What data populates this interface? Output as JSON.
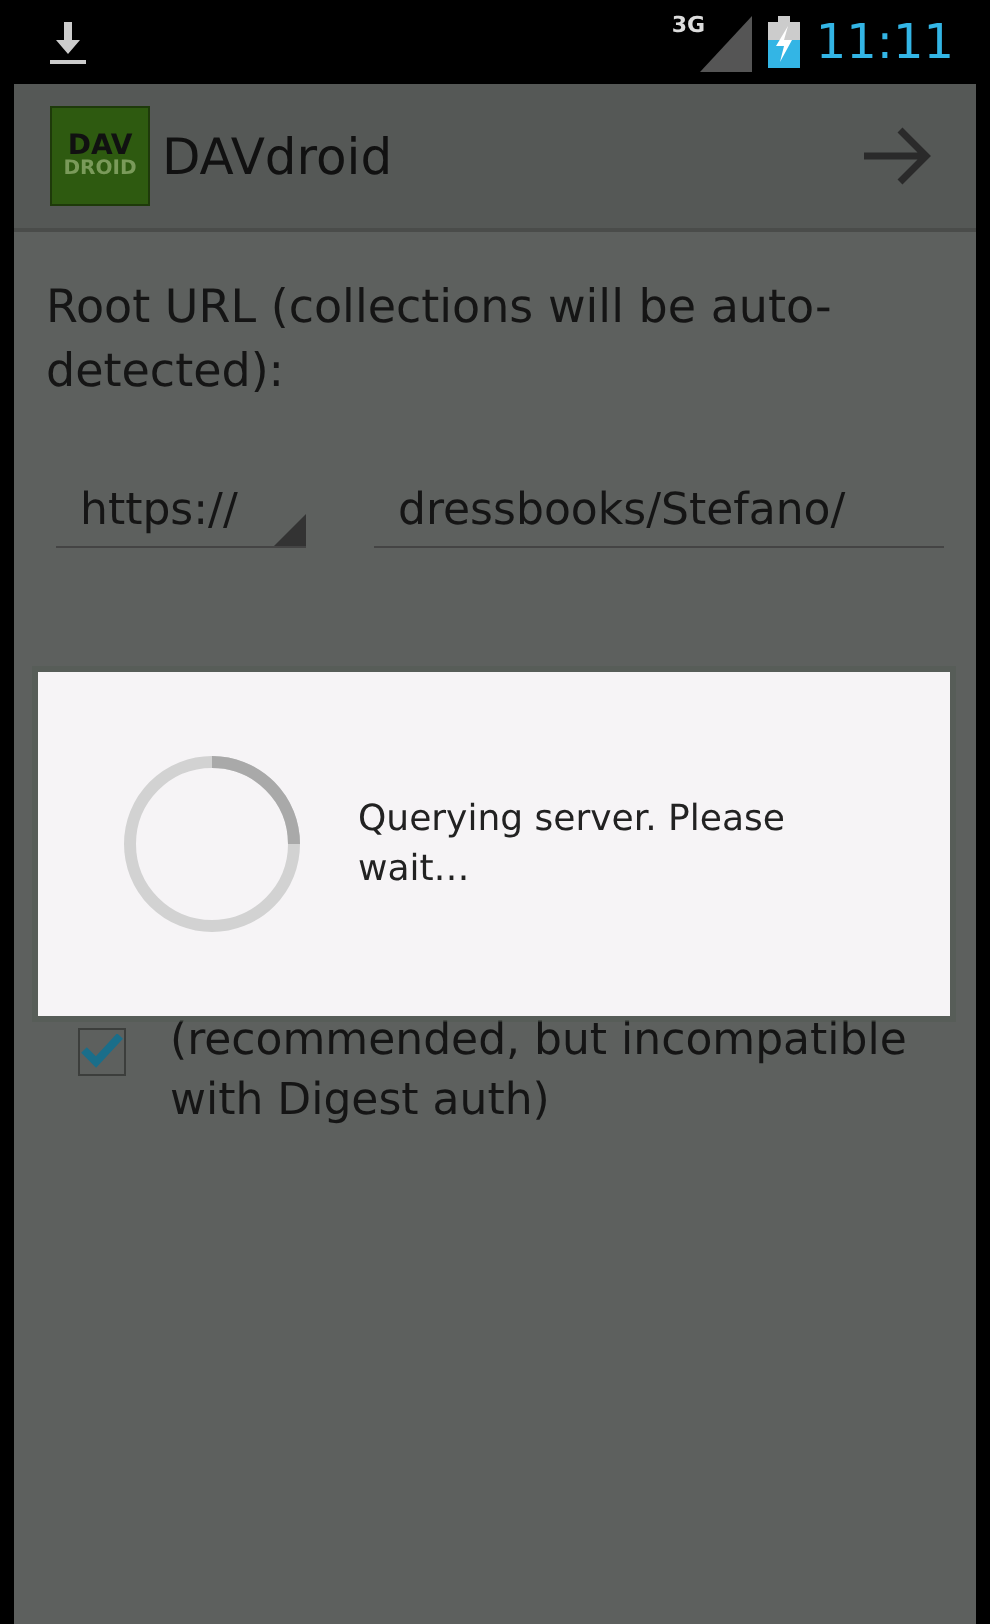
{
  "status_bar": {
    "network": "3G",
    "time": "11:11"
  },
  "action_bar": {
    "logo": {
      "top": "DAV",
      "bottom": "DROID"
    },
    "title": "DAVdroid"
  },
  "form": {
    "root_url_label": "Root URL (collections will be auto-detected):",
    "scheme": "https://",
    "url_value": "dressbooks/Stefano/",
    "preemptive": {
      "checked": true,
      "text": "(recommended, but incompatible with Digest auth)"
    }
  },
  "dialog": {
    "message": "Querying server. Please wait…"
  }
}
